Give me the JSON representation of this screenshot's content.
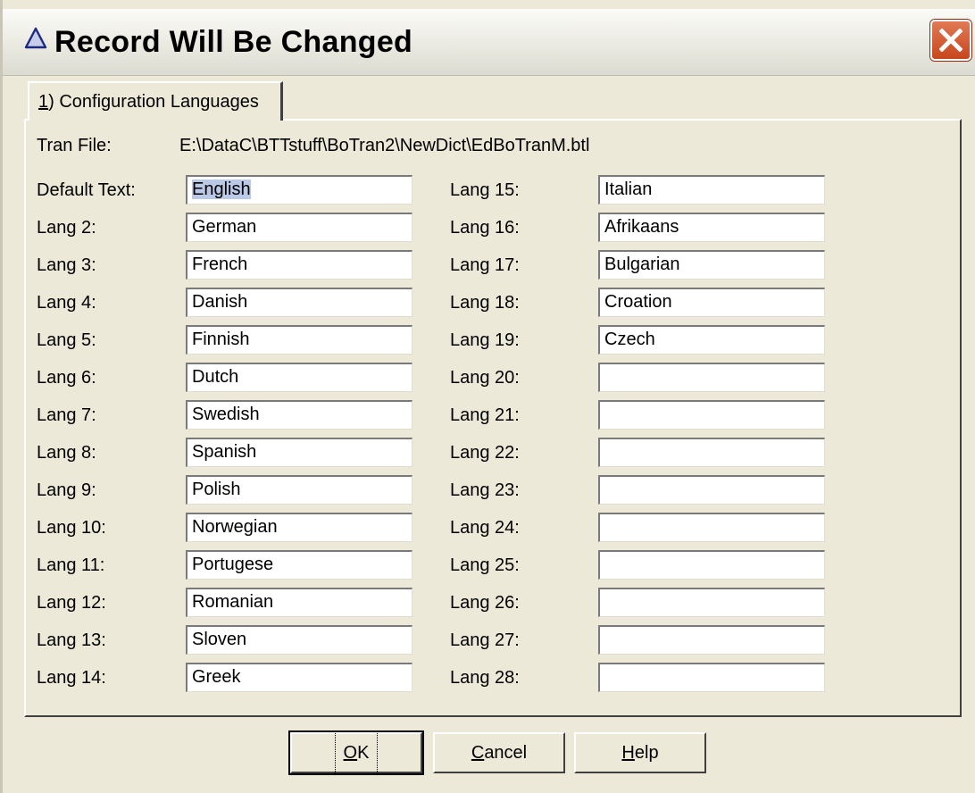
{
  "window": {
    "title": "Record Will Be Changed",
    "title_icon": "warning-triangle-icon",
    "close_icon": "close-icon"
  },
  "tab": {
    "accel": "1",
    "rest": ") Configuration Languages"
  },
  "tran_file": {
    "label": "Tran File:",
    "value": "E:\\DataC\\BTTstuff\\BoTran2\\NewDict\\EdBoTranM.btl"
  },
  "languages_left": [
    {
      "label": "Default Text:",
      "value": "English"
    },
    {
      "label": "Lang 2:",
      "value": "German"
    },
    {
      "label": "Lang 3:",
      "value": "French"
    },
    {
      "label": "Lang 4:",
      "value": "Danish"
    },
    {
      "label": "Lang 5:",
      "value": "Finnish"
    },
    {
      "label": "Lang 6:",
      "value": "Dutch"
    },
    {
      "label": "Lang 7:",
      "value": "Swedish"
    },
    {
      "label": "Lang 8:",
      "value": "Spanish"
    },
    {
      "label": "Lang 9:",
      "value": "Polish"
    },
    {
      "label": "Lang 10:",
      "value": "Norwegian"
    },
    {
      "label": "Lang 11:",
      "value": "Portugese"
    },
    {
      "label": "Lang 12:",
      "value": "Romanian"
    },
    {
      "label": "Lang 13:",
      "value": "Sloven"
    },
    {
      "label": "Lang 14:",
      "value": "Greek"
    }
  ],
  "languages_right": [
    {
      "label": "Lang 15:",
      "value": "Italian"
    },
    {
      "label": "Lang 16:",
      "value": "Afrikaans"
    },
    {
      "label": "Lang 17:",
      "value": "Bulgarian"
    },
    {
      "label": "Lang 18:",
      "value": "Croation"
    },
    {
      "label": "Lang 19:",
      "value": "Czech"
    },
    {
      "label": "Lang 20:",
      "value": ""
    },
    {
      "label": "Lang 21:",
      "value": ""
    },
    {
      "label": "Lang 22:",
      "value": ""
    },
    {
      "label": "Lang 23:",
      "value": ""
    },
    {
      "label": "Lang 24:",
      "value": ""
    },
    {
      "label": "Lang 25:",
      "value": ""
    },
    {
      "label": "Lang 26:",
      "value": ""
    },
    {
      "label": "Lang 27:",
      "value": ""
    },
    {
      "label": "Lang 28:",
      "value": ""
    }
  ],
  "buttons": {
    "ok": {
      "accel": "O",
      "rest": "K"
    },
    "cancel": {
      "accel": "C",
      "rest": "ancel"
    },
    "help": {
      "accel": "H",
      "rest": "elp"
    }
  },
  "colors": {
    "dialog_bg": "#ece9d8",
    "selection": "#b9c9e6",
    "close_button": "#c8461e"
  }
}
